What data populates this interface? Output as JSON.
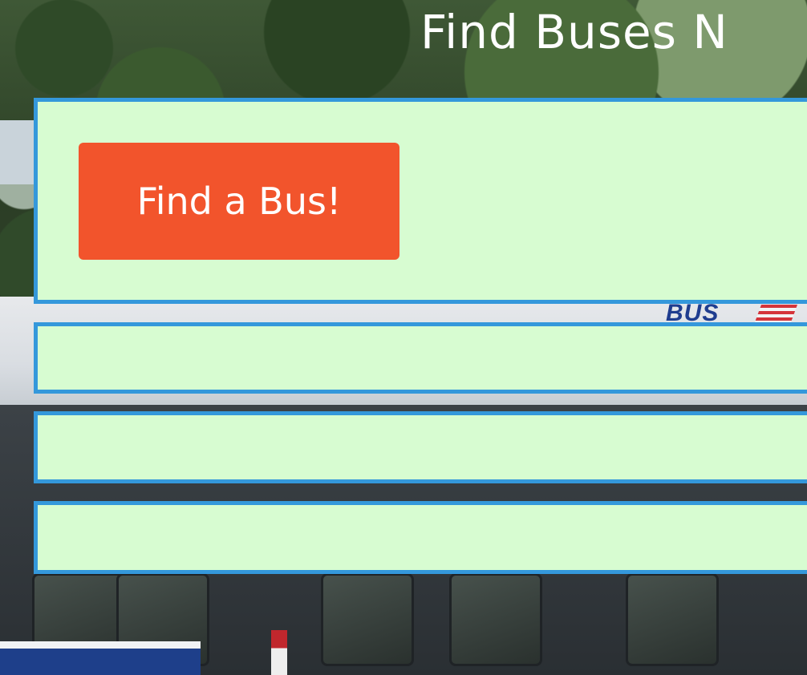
{
  "header": {
    "title": "Find Buses N"
  },
  "main_panel": {
    "find_button_label": "Find a Bus!"
  },
  "colors": {
    "panel_background": "#d7fcd1",
    "panel_border": "#3498db",
    "button_background": "#f2542c",
    "title_text": "#ffffff"
  },
  "icons": [
    "background-photo"
  ]
}
